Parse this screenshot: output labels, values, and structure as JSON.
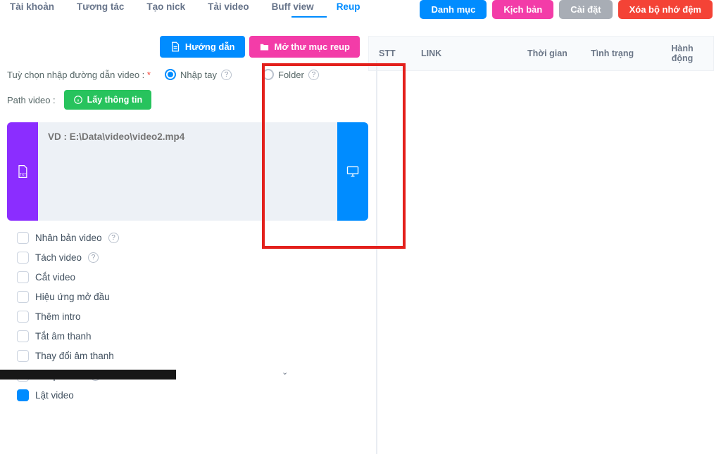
{
  "tabs": {
    "taikhoan": "Tài khoản",
    "tuongtac": "Tương tác",
    "taonick": "Tạo nick",
    "taivideo": "Tải video",
    "buffview": "Buff view",
    "reup": "Reup"
  },
  "top_buttons": {
    "danhmuc": "Danh mục",
    "kichban": "Kịch bản",
    "caidat": "Cài đặt",
    "xoabonhodem": "Xóa bộ nhớ đệm"
  },
  "mid_buttons": {
    "huongdan": "Hướng dẫn",
    "mothumucreup": "Mở thư mục reup"
  },
  "options": {
    "label": "Tuỳ chọn nhập đường dẫn video :",
    "star": "*",
    "nhaptay": "Nhập tay",
    "folder": "Folder"
  },
  "path": {
    "label": "Path video :",
    "button": "Lấy thông tin",
    "placeholder": "VD : E:\\Data\\video\\video2.mp4"
  },
  "checks": {
    "nhanban": "Nhân bản video",
    "tach": "Tách video",
    "cat": "Cắt video",
    "hieuung": "Hiệu ứng mở đầu",
    "themintro": "Thêm intro",
    "tatam": "Tắt âm thanh",
    "thaydoiam": "Thay đổi âm thanh",
    "ghep": "Ghép video",
    "lat": "Lật video"
  },
  "table_head": {
    "stt": "STT",
    "link": "LINK",
    "thoigian": "Thời gian",
    "tinhtrang": "Tình trạng",
    "hanhdong": "Hành động"
  }
}
